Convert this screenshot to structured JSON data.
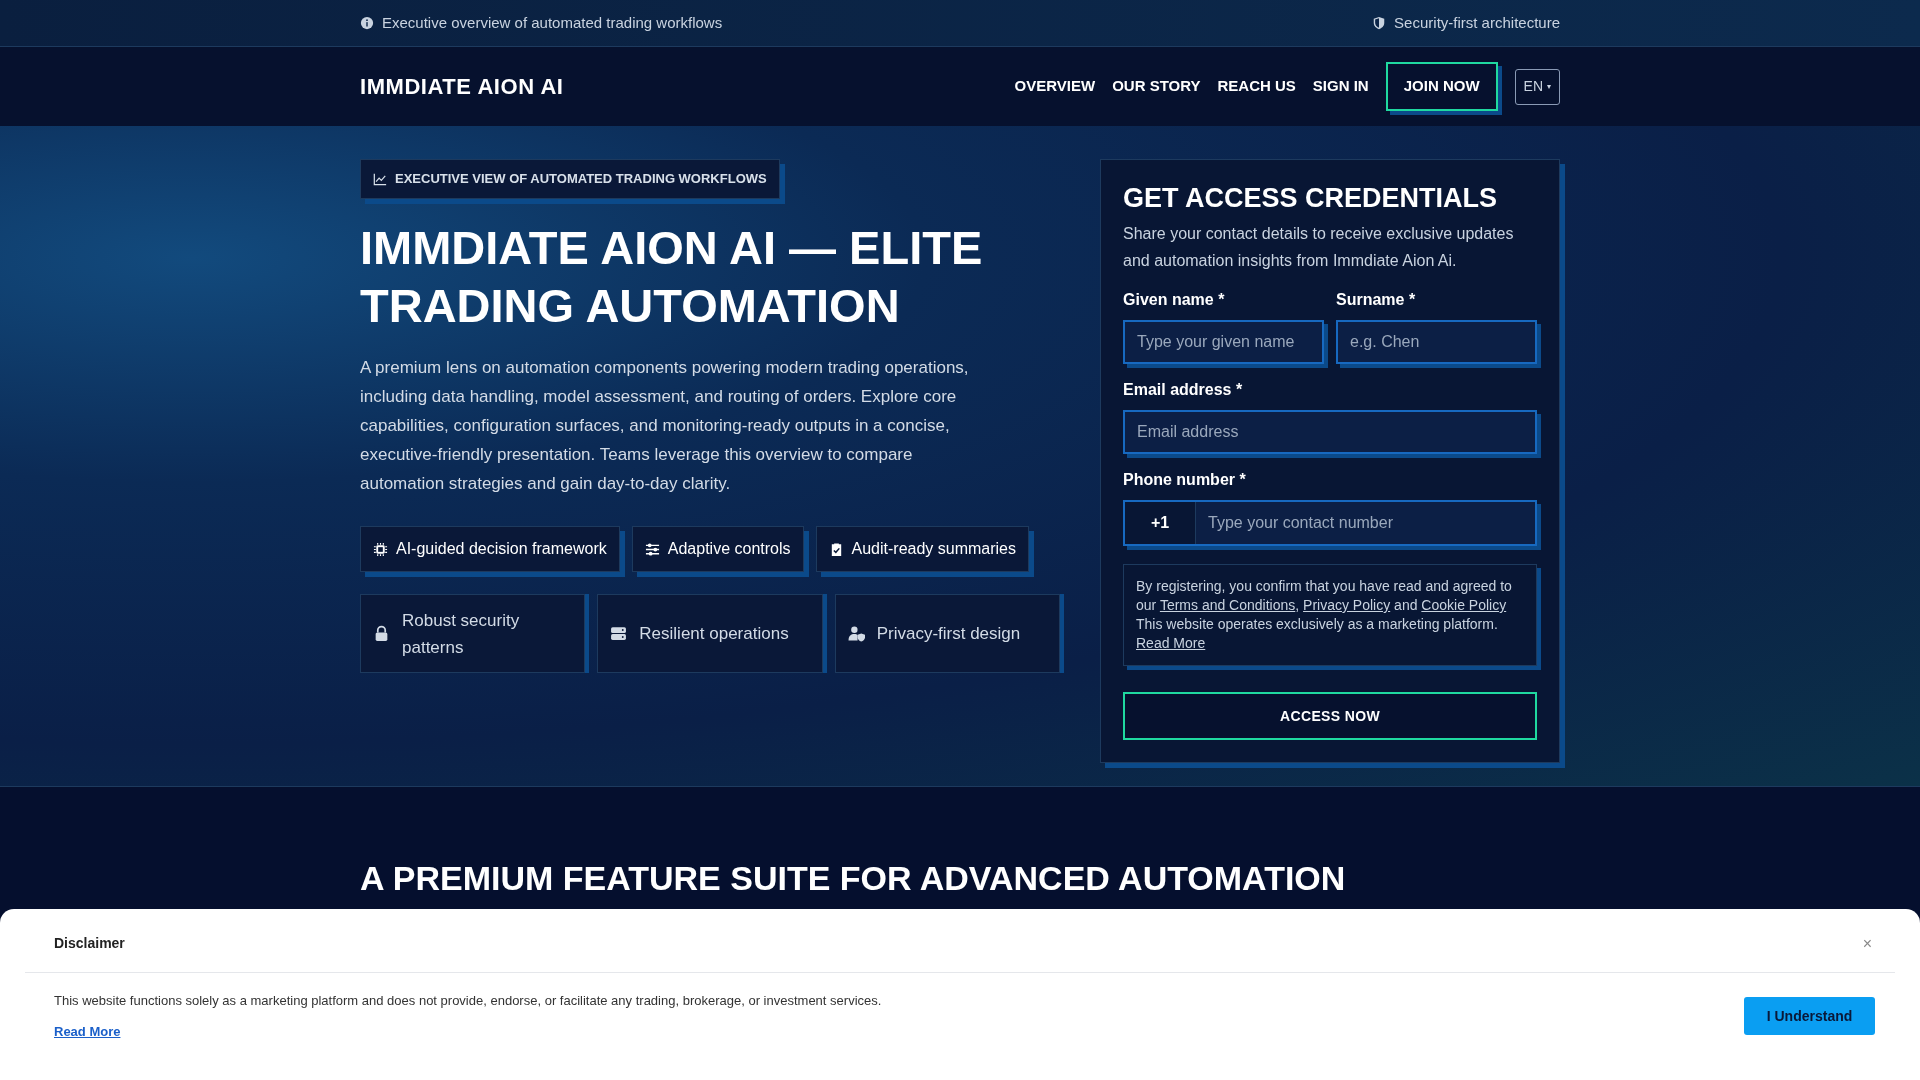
{
  "top_bar": {
    "left_text": "Executive overview of automated trading workflows",
    "right_text": "Security-first architecture"
  },
  "nav": {
    "logo": "IMMDIATE AION AI",
    "links": [
      "OVERVIEW",
      "OUR STORY",
      "REACH US",
      "SIGN IN"
    ],
    "join_button": "JOIN NOW",
    "language": "EN",
    "language_caret": "▾"
  },
  "hero": {
    "eyebrow": "EXECUTIVE VIEW OF AUTOMATED TRADING WORKFLOWS",
    "title": "IMMDIATE AION AI — ELITE TRADING AUTOMATION",
    "description": "A premium lens on automation components powering modern trading operations, including data handling, model assessment, and routing of orders. Explore core capabilities, configuration surfaces, and monitoring-ready outputs in a concise, executive-friendly presentation. Teams leverage this overview to compare automation strategies and gain day-to-day clarity.",
    "chips": [
      "AI-guided decision framework",
      "Adaptive controls",
      "Audit-ready summaries"
    ],
    "features": [
      "Robust security patterns",
      "Resilient operations",
      "Privacy-first design"
    ]
  },
  "form": {
    "title": "GET ACCESS CREDENTIALS",
    "subtitle": "Share your contact details to receive exclusive updates and automation insights from Immdiate Aion Ai.",
    "fields": [
      {
        "kind": "half",
        "label": "Given name *",
        "placeholder": "Type your given name"
      },
      {
        "kind": "half",
        "label": "Surname *",
        "placeholder": "e.g. Chen"
      },
      {
        "kind": "full",
        "label": "Email address *",
        "placeholder": "Email address"
      },
      {
        "kind": "phone",
        "label": "Phone number *",
        "prefix": "+1",
        "placeholder": "Type your contact number"
      }
    ],
    "consent": [
      {
        "kind": "text",
        "text": "By registering, you confirm that you have read and agreed to our "
      },
      {
        "kind": "link",
        "text": "Terms and Conditions"
      },
      {
        "kind": "text",
        "text": ", "
      },
      {
        "kind": "link",
        "text": "Privacy Policy"
      },
      {
        "kind": "text",
        "text": " and "
      },
      {
        "kind": "link",
        "text": "Cookie Policy"
      },
      {
        "kind": "text",
        "text": " This website operates exclusively as a marketing platform. "
      },
      {
        "kind": "link",
        "text": "Read More"
      }
    ],
    "submit": "ACCESS NOW"
  },
  "section": {
    "heading": "A PREMIUM FEATURE SUITE FOR ADVANCED AUTOMATION"
  },
  "disclaimer": {
    "title": "Disclaimer",
    "close": "×",
    "body": "This website functions solely as a marketing platform and does not provide, endorse, or facilitate any trading, brokerage, or investment services.",
    "read_more": "Read More",
    "button": "I Understand"
  }
}
